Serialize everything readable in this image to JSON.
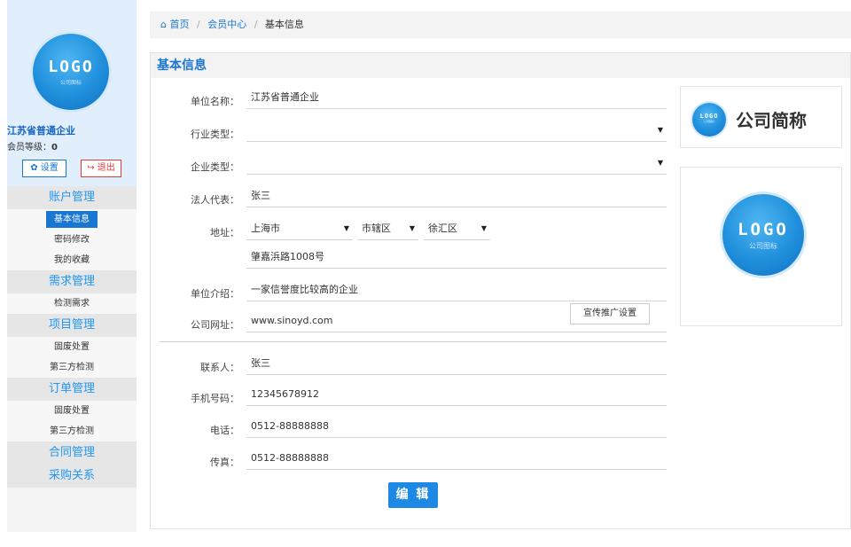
{
  "breadcrumb": {
    "home": "首页",
    "crumb1": "会员中心",
    "current": "基本信息",
    "sep": "/"
  },
  "sidebar": {
    "logo_text": "LOGO",
    "logo_subtext": "公司图标",
    "company_name": "江苏省普通企业",
    "member_level_label": "会员等级：",
    "member_level_value": "0",
    "settings_label": "设置",
    "logout_label": "退出",
    "nav": [
      {
        "label": "账户管理",
        "items": [
          "基本信息",
          "密码修改",
          "我的收藏"
        ]
      },
      {
        "label": "需求管理",
        "items": [
          "检测需求"
        ]
      },
      {
        "label": "项目管理",
        "items": [
          "固废处置",
          "第三方检测"
        ]
      },
      {
        "label": "订单管理",
        "items": [
          "固废处置",
          "第三方检测"
        ]
      },
      {
        "label": "合同管理",
        "items": []
      },
      {
        "label": "采购关系",
        "items": []
      }
    ]
  },
  "panel": {
    "title": "基本信息"
  },
  "form": {
    "unit_name": {
      "label": "单位名称：",
      "value": "江苏省普通企业"
    },
    "industry_type": {
      "label": "行业类型：",
      "value": ""
    },
    "enterprise_type": {
      "label": "企业类型：",
      "value": ""
    },
    "legal_rep": {
      "label": "法人代表：",
      "value": "张三"
    },
    "address": {
      "label": "地址：",
      "province": "上海市",
      "city": "市辖区",
      "district": "徐汇区",
      "detail": "肇嘉浜路1008号"
    },
    "intro": {
      "label": "单位介绍：",
      "value": "一家信誉度比较高的企业"
    },
    "website": {
      "label": "公司网址：",
      "value": "www.sinoyd.com"
    },
    "contact": {
      "label": "联系人：",
      "value": "张三"
    },
    "mobile": {
      "label": "手机号码：",
      "value": "12345678912"
    },
    "phone": {
      "label": "电话：",
      "value": "0512-88888888"
    },
    "fax": {
      "label": "传真：",
      "value": "0512-88888888"
    },
    "edit_button": "编 辑"
  },
  "brand": {
    "short_name": "公司简称",
    "logo_text": "LOGO",
    "logo_subtext": "公司图标"
  },
  "promo_button": "宣传推广设置",
  "colors": {
    "accent": "#1976d2",
    "danger": "#e53935",
    "nav_text": "#2196f3"
  }
}
